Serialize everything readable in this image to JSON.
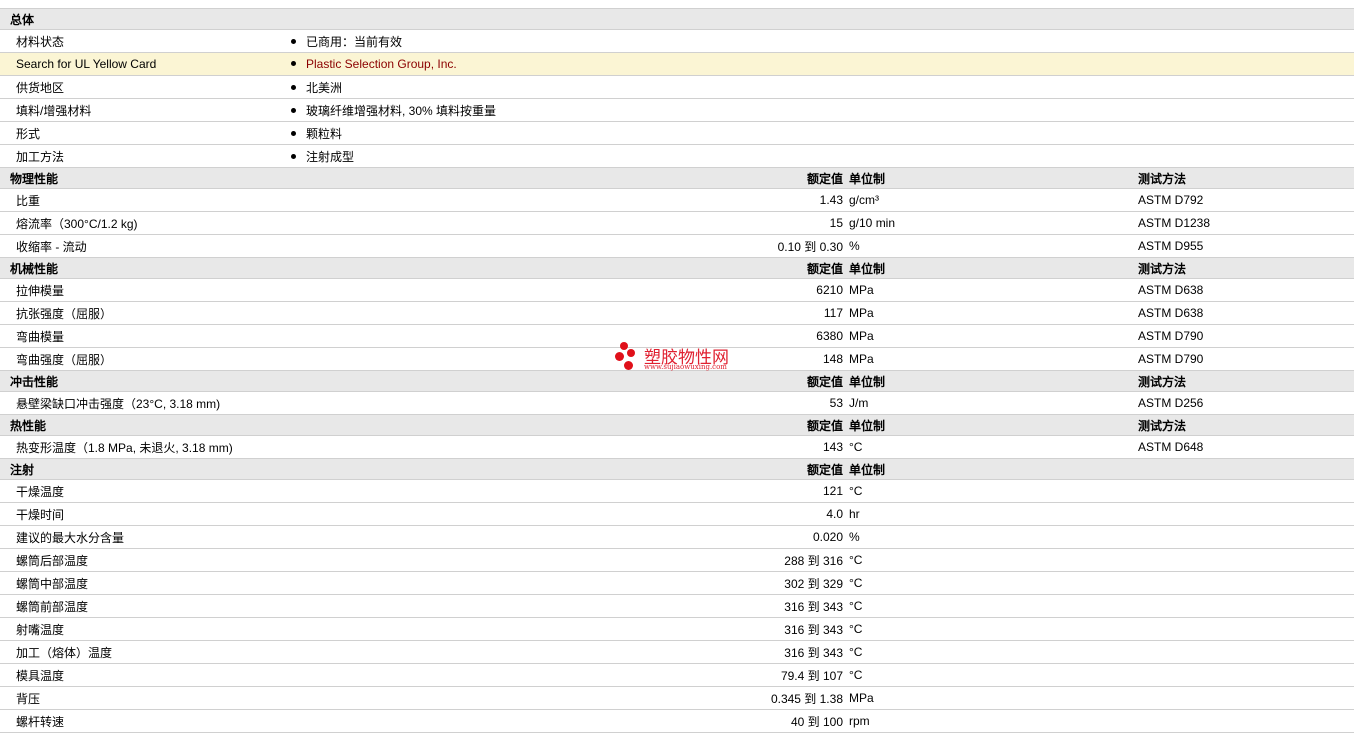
{
  "general": {
    "title": "总体",
    "rows": [
      {
        "name": "材料状态",
        "value": "已商用：当前有效",
        "link": false
      },
      {
        "name": "Search for UL Yellow Card",
        "value": "Plastic Selection Group, Inc.",
        "link": true
      },
      {
        "name": "供货地区",
        "value": "北美洲",
        "link": false
      },
      {
        "name": "填料/增强材料",
        "value": "玻璃纤维增强材料, 30% 填料按重量",
        "link": false
      },
      {
        "name": "形式",
        "value": "颗粒料",
        "link": false
      },
      {
        "name": "加工方法",
        "value": "注射成型",
        "link": false
      }
    ]
  },
  "sections": [
    {
      "title": "物理性能",
      "col_value": "额定值",
      "col_unit": "单位制",
      "col_method": "测试方法",
      "rows": [
        {
          "name": "比重",
          "value": "1.43",
          "unit": "g/cm³",
          "method": "ASTM D792"
        },
        {
          "name": "熔流率（300°C/1.2 kg)",
          "value": "15",
          "unit": "g/10 min",
          "method": "ASTM D1238"
        },
        {
          "name": "收缩率 - 流动",
          "value": "0.10 到  0.30",
          "unit": "%",
          "method": "ASTM D955"
        }
      ]
    },
    {
      "title": "机械性能",
      "col_value": "额定值",
      "col_unit": "单位制",
      "col_method": "测试方法",
      "rows": [
        {
          "name": "拉伸模量",
          "value": "6210",
          "unit": "MPa",
          "method": "ASTM D638"
        },
        {
          "name": "抗张强度（屈服）",
          "value": "117",
          "unit": "MPa",
          "method": "ASTM D638"
        },
        {
          "name": "弯曲模量",
          "value": "6380",
          "unit": "MPa",
          "method": "ASTM D790"
        },
        {
          "name": "弯曲强度（屈服）",
          "value": "148",
          "unit": "MPa",
          "method": "ASTM D790"
        }
      ]
    },
    {
      "title": "冲击性能",
      "col_value": "额定值",
      "col_unit": "单位制",
      "col_method": "测试方法",
      "rows": [
        {
          "name": "悬壁梁缺口冲击强度（23°C, 3.18 mm)",
          "value": "53",
          "unit": "J/m",
          "method": "ASTM D256"
        }
      ]
    },
    {
      "title": "热性能",
      "col_value": "额定值",
      "col_unit": "单位制",
      "col_method": "测试方法",
      "rows": [
        {
          "name": "热变形温度（1.8 MPa, 未退火, 3.18 mm)",
          "value": "143",
          "unit": "°C",
          "method": "ASTM D648"
        }
      ]
    },
    {
      "title": "注射",
      "col_value": "额定值",
      "col_unit": "单位制",
      "col_method": "",
      "rows": [
        {
          "name": "干燥温度",
          "value": "121",
          "unit": "°C",
          "method": ""
        },
        {
          "name": "干燥时间",
          "value": "4.0",
          "unit": "hr",
          "method": ""
        },
        {
          "name": "建议的最大水分含量",
          "value": "0.020",
          "unit": "%",
          "method": ""
        },
        {
          "name": "螺筒后部温度",
          "value": "288 到  316",
          "unit": "°C",
          "method": ""
        },
        {
          "name": "螺筒中部温度",
          "value": "302 到  329",
          "unit": "°C",
          "method": ""
        },
        {
          "name": "螺筒前部温度",
          "value": "316 到  343",
          "unit": "°C",
          "method": ""
        },
        {
          "name": "射嘴温度",
          "value": "316 到  343",
          "unit": "°C",
          "method": ""
        },
        {
          "name": "加工（熔体）温度",
          "value": "316 到  343",
          "unit": "°C",
          "method": ""
        },
        {
          "name": "模具温度",
          "value": "79.4 到  107",
          "unit": "°C",
          "method": ""
        },
        {
          "name": "背压",
          "value": "0.345 到  1.38",
          "unit": "MPa",
          "method": ""
        },
        {
          "name": "螺杆转速",
          "value": "40 到  100",
          "unit": "rpm",
          "method": ""
        }
      ]
    }
  ],
  "watermark": {
    "title": "塑胶物性网",
    "url": "www.sujiaowuxing.com",
    "color": "#e0101a"
  }
}
